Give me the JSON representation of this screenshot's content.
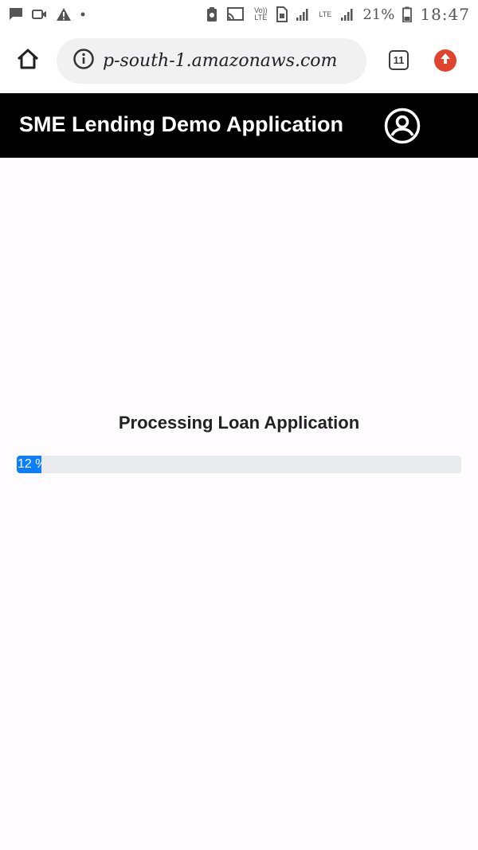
{
  "status_bar": {
    "time": "18:47",
    "battery_percent": "21%",
    "network_label_1": "Vo)) LTE",
    "network_label_2": "LTE",
    "icons": [
      "message-icon",
      "video-camera-icon",
      "warning-icon",
      "dot-icon",
      "clipboard-icon",
      "cast-icon",
      "sim-icon",
      "signal-icon",
      "battery-icon"
    ]
  },
  "browser": {
    "url": "p-south-1.amazonaws.com",
    "tab_count": "11",
    "icons": [
      "home-icon",
      "info-icon",
      "tabs-icon",
      "update-icon"
    ]
  },
  "app": {
    "title": "SME Lending Demo Application",
    "account_icon": "account-circle-icon"
  },
  "processing": {
    "title": "Processing Loan Application",
    "progress_label": "12 %",
    "progress_value": 0.055
  },
  "colors": {
    "header_bg": "#000000",
    "progress_fill": "#0d7ffc",
    "progress_track": "#e9eaee",
    "update_badge": "#e0442d"
  }
}
